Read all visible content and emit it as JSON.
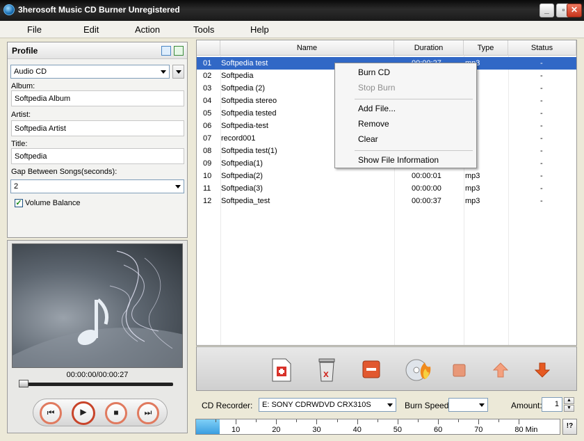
{
  "window": {
    "title": "3herosoft Music CD Burner Unregistered"
  },
  "menu": [
    "File",
    "Edit",
    "Action",
    "Tools",
    "Help"
  ],
  "profile": {
    "header": "Profile",
    "format": "Audio CD",
    "album_label": "Album:",
    "album": "Softpedia Album",
    "artist_label": "Artist:",
    "artist": "Softpedia Artist",
    "title_label": "Title:",
    "title": "Softpedia",
    "gap_label": "Gap Between Songs(seconds):",
    "gap": "2",
    "volume_balance_label": "Volume Balance",
    "volume_balance_checked": true
  },
  "player": {
    "time": "00:00:00/00:00:27",
    "seek_fraction": 0.0
  },
  "list": {
    "columns": [
      "Name",
      "Duration",
      "Type",
      "Status"
    ],
    "rows": [
      {
        "no": "01",
        "name": "Softpedia test",
        "duration": "00:00:27",
        "type": "mp3",
        "status": "-"
      },
      {
        "no": "02",
        "name": "Softpedia",
        "duration": "",
        "type": "",
        "status": "-"
      },
      {
        "no": "03",
        "name": "Softpedia (2)",
        "duration": "",
        "type": "",
        "status": "-"
      },
      {
        "no": "04",
        "name": "Softpedia stereo",
        "duration": "",
        "type": "",
        "status": "-"
      },
      {
        "no": "05",
        "name": "Softpedia tested",
        "duration": "",
        "type": "",
        "status": "-"
      },
      {
        "no": "06",
        "name": "Softpedia-test",
        "duration": "",
        "type": "",
        "status": "-"
      },
      {
        "no": "07",
        "name": "record001",
        "duration": "",
        "type": "",
        "status": "-"
      },
      {
        "no": "08",
        "name": "Softpedia test(1)",
        "duration": "",
        "type": "",
        "status": "-"
      },
      {
        "no": "09",
        "name": "Softpedia(1)",
        "duration": "",
        "type": "",
        "status": "-"
      },
      {
        "no": "10",
        "name": "Softpedia(2)",
        "duration": "00:00:01",
        "type": "mp3",
        "status": "-"
      },
      {
        "no": "11",
        "name": "Softpedia(3)",
        "duration": "00:00:00",
        "type": "mp3",
        "status": "-"
      },
      {
        "no": "12",
        "name": "Softpedia_test",
        "duration": "00:00:37",
        "type": "mp3",
        "status": "-"
      }
    ]
  },
  "context_menu": {
    "burn_cd": "Burn CD",
    "stop_burn": "Stop Burn",
    "add_file": "Add File...",
    "remove": "Remove",
    "clear": "Clear",
    "show_info": "Show File Information"
  },
  "bottom": {
    "recorder_label": "CD Recorder:",
    "recorder": "E: SONY CDRWDVD CRX310S",
    "speed_label": "Burn Speed:",
    "speed": "",
    "amount_label": "Amount:",
    "amount": "1",
    "help": "!?",
    "capacity_ticks": [
      "10",
      "20",
      "30",
      "40",
      "50",
      "60",
      "70",
      "80 Min"
    ],
    "capacity_fill_min": 0.6
  },
  "colors": {
    "selection": "#3168c6",
    "accent": "#e07a5f",
    "title_bar": "#1a1a1a"
  }
}
